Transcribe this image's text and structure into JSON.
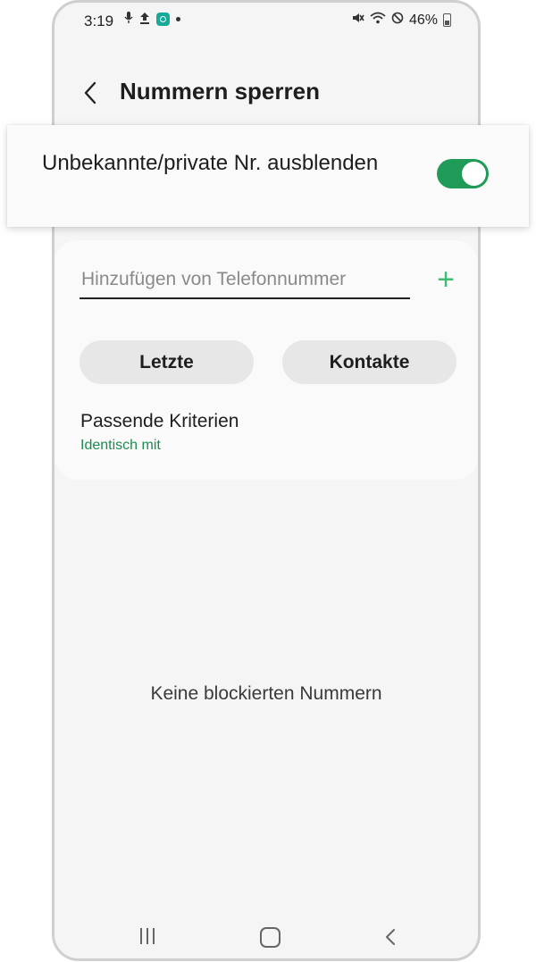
{
  "status_bar": {
    "time": "3:19",
    "battery": "46%",
    "left_icons": [
      "microphone-icon",
      "upload-icon",
      "app-notification-icon",
      "dot-icon"
    ],
    "right_icons": [
      "mute-icon",
      "wifi-icon",
      "do-not-disturb-icon",
      "battery-icon"
    ]
  },
  "header": {
    "title": "Nummern sperren",
    "back_icon": "chevron-left-icon"
  },
  "toggle_setting": {
    "label": "Unbekannte/private Nr. ausblenden",
    "enabled": true
  },
  "add_number": {
    "placeholder": "Hinzufügen von Telefonnummer",
    "value": "",
    "add_symbol": "+"
  },
  "buttons": {
    "recent": "Letzte",
    "contacts": "Kontakte"
  },
  "criteria": {
    "label": "Passende Kriterien",
    "value": "Identisch mit"
  },
  "empty_state": "Keine blockierten Nummern",
  "colors": {
    "accent_green": "#1f9a57",
    "add_green": "#3ebc72",
    "criteria_green": "#1e8a50"
  },
  "nav_bar": [
    "recent-apps-icon",
    "home-icon",
    "back-icon"
  ]
}
